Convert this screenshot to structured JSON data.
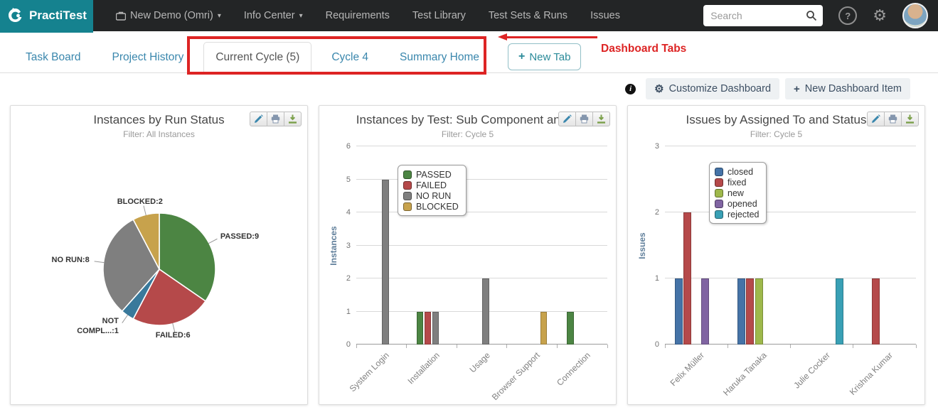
{
  "navbar": {
    "brand": "PractiTest",
    "project": "New Demo (Omri)",
    "menu": [
      "Info Center",
      "Requirements",
      "Test Library",
      "Test Sets & Runs",
      "Issues"
    ],
    "search_placeholder": "Search"
  },
  "icons": {
    "caret": "▾",
    "gear": "⚙",
    "help": "?",
    "info": "i",
    "plus": "+"
  },
  "tabs": {
    "items": [
      {
        "label": "Task Board",
        "active": false
      },
      {
        "label": "Project History",
        "active": false
      },
      {
        "label": "Current Cycle (5)",
        "active": true
      },
      {
        "label": "Cycle 4",
        "active": false
      },
      {
        "label": "Summary Home",
        "active": false
      }
    ],
    "new_tab": "New Tab"
  },
  "annotation": {
    "label": "Dashboard Tabs",
    "color": "#dd2424"
  },
  "actions": {
    "customize": "Customize Dashboard",
    "new_item": "New Dashboard Item"
  },
  "chart_data": [
    {
      "type": "pie",
      "title": "Instances by Run Status",
      "subtitle": "Filter: All Instances",
      "labels": [
        "PASSED",
        "FAILED",
        "NOT COMPL...",
        "NO RUN",
        "BLOCKED"
      ],
      "values": [
        9,
        6,
        1,
        8,
        2
      ],
      "colors": [
        "#4c8543",
        "#b5494a",
        "#39799b",
        "#7f7f7f",
        "#c7a24c"
      ],
      "start_angle_deg": 0,
      "direction": "clockwise",
      "label_format": "NAME:VALUE"
    },
    {
      "type": "bar",
      "title": "Instances by Test: Sub Component and R",
      "subtitle": "Filter: Cycle 5",
      "ylabel": "Instances",
      "ylim": [
        0,
        6
      ],
      "grid": true,
      "legend_position": "overlay-top-left",
      "legend_pos": [
        58,
        26
      ],
      "categories": [
        "System Login",
        "Installation",
        "Usage",
        "Browser Support",
        "Connection"
      ],
      "series": [
        {
          "name": "PASSED",
          "color": "#4c8543",
          "values": [
            0,
            1,
            0,
            0,
            1
          ]
        },
        {
          "name": "FAILED",
          "color": "#b5494a",
          "values": [
            0,
            1,
            0,
            0,
            0
          ]
        },
        {
          "name": "NO RUN",
          "color": "#7f7f7f",
          "values": [
            5,
            1,
            2,
            0,
            0
          ]
        },
        {
          "name": "BLOCKED",
          "color": "#c7a24c",
          "values": [
            0,
            0,
            0,
            1,
            0
          ]
        }
      ]
    },
    {
      "type": "bar",
      "title": "Issues by Assigned To and Status",
      "subtitle": "Filter: Cycle 5",
      "ylabel": "Issues",
      "ylim": [
        0,
        3
      ],
      "grid": true,
      "legend_position": "overlay-top-left",
      "legend_pos": [
        62,
        22
      ],
      "categories": [
        "Felix Müller",
        "Haruka Tanaka",
        "Julie Cocker",
        "Krishna Kumar"
      ],
      "series": [
        {
          "name": "closed",
          "color": "#4573a7",
          "values": [
            1,
            1,
            0,
            0
          ]
        },
        {
          "name": "fixed",
          "color": "#b5494a",
          "values": [
            2,
            1,
            0,
            1
          ]
        },
        {
          "name": "new",
          "color": "#9eb84b",
          "values": [
            0,
            1,
            0,
            0
          ]
        },
        {
          "name": "opened",
          "color": "#8064a2",
          "values": [
            1,
            0,
            0,
            0
          ]
        },
        {
          "name": "rejected",
          "color": "#39a0b5",
          "values": [
            0,
            0,
            1,
            0
          ]
        }
      ]
    }
  ]
}
